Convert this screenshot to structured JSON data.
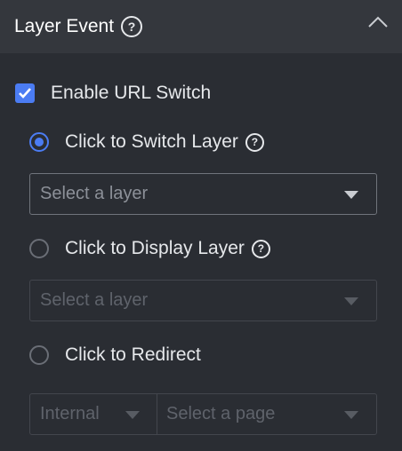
{
  "header": {
    "title": "Layer Event",
    "help_glyph": "?"
  },
  "enable_url_switch": {
    "label": "Enable URL Switch",
    "checked": true
  },
  "options": [
    {
      "label": "Click to Switch Layer",
      "selected": true,
      "has_help": true,
      "help_glyph": "?"
    },
    {
      "label": "Click to Display Layer",
      "selected": false,
      "has_help": true,
      "help_glyph": "?"
    },
    {
      "label": "Click to Redirect",
      "selected": false,
      "has_help": false
    }
  ],
  "switch_layer_select": {
    "placeholder": "Select a layer",
    "enabled": true
  },
  "display_layer_select": {
    "placeholder": "Select a layer",
    "enabled": false
  },
  "redirect": {
    "type_select": {
      "value": "Internal",
      "enabled": false
    },
    "page_select": {
      "placeholder": "Select a page",
      "enabled": false
    }
  },
  "colors": {
    "accent": "#4b7cf3",
    "background": "#2a2d33",
    "header": "#34373d"
  }
}
